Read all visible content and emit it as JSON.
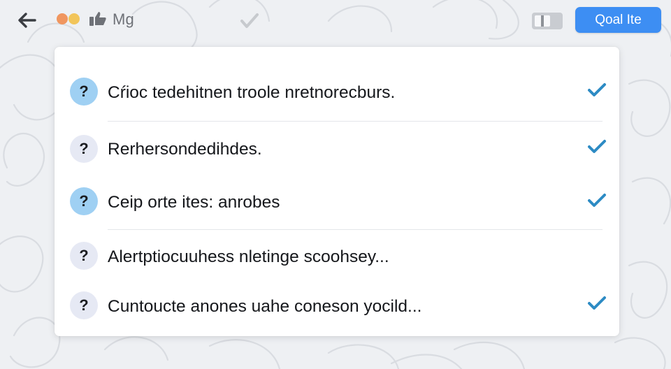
{
  "header": {
    "title": "Mg",
    "primary_button_label": "Qoal Ite",
    "icons": {
      "back": "back-arrow-icon",
      "thumb": "thumbs-up-icon",
      "check": "check-icon",
      "toggle": "toggle-icon"
    },
    "window_dots": [
      "#f0965f",
      "#f2c55a"
    ]
  },
  "questions": [
    {
      "text": "Cŕioc tedehitnen troole nretnorecburs.",
      "status": "active",
      "checked": true
    },
    {
      "text": "Rerhersondedihdes.",
      "status": "inactive",
      "checked": true
    },
    {
      "text": "Ceip orte ites: anrobes",
      "status": "active",
      "checked": true
    },
    {
      "text": "Alertptiocuuhess nletinge scoohsey...",
      "status": "inactive",
      "checked": false
    },
    {
      "text": "Cuntoucte anones uahe coneson yocild...",
      "status": "inactive",
      "checked": true
    }
  ],
  "colors": {
    "accent": "#3d8ef3",
    "check": "#2d8bc4",
    "badge_active": "#9fd0f3",
    "badge_inactive": "#e6e9f4",
    "background": "#eef0f3"
  }
}
